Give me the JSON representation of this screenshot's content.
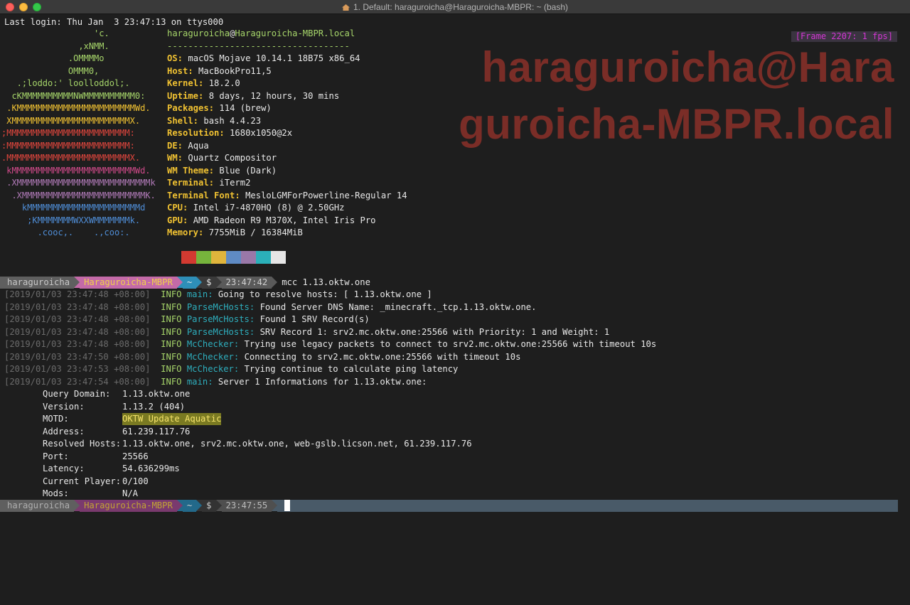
{
  "window": {
    "title": "1. Default: haraguroicha@Haraguroicha-MBPR: ~ (bash)",
    "fps_badge": "[Frame 2207: 1 fps]"
  },
  "last_login": "Last login: Thu Jan  3 23:47:13 on ttys000",
  "logo_lines": [
    {
      "text": "                  'c.",
      "color": "#a6d56a"
    },
    {
      "text": "               ,xNMM.",
      "color": "#a6d56a"
    },
    {
      "text": "             .OMMMMo",
      "color": "#a6d56a"
    },
    {
      "text": "             OMMM0,",
      "color": "#a6d56a"
    },
    {
      "text": "   .;loddo:' loolloddol;.",
      "color": "#a6d56a"
    },
    {
      "text": "  cKMMMMMMMMMMNWMMMMMMMMMM0:",
      "color": "#a6d56a"
    },
    {
      "text": " .KMMMMMMMMMMMMMMMMMMMMMMMWd.",
      "color": "#f1c232"
    },
    {
      "text": " XMMMMMMMMMMMMMMMMMMMMMMMX.",
      "color": "#f1c232"
    },
    {
      "text": ";MMMMMMMMMMMMMMMMMMMMMMMM:",
      "color": "#e0463d"
    },
    {
      "text": ":MMMMMMMMMMMMMMMMMMMMMMMM:",
      "color": "#e0463d"
    },
    {
      "text": ".MMMMMMMMMMMMMMMMMMMMMMMMX.",
      "color": "#e0463d"
    },
    {
      "text": " kMMMMMMMMMMMMMMMMMMMMMMMMWd.",
      "color": "#d04a8a"
    },
    {
      "text": " .XMMMMMMMMMMMMMMMMMMMMMMMMMMk",
      "color": "#b07ab7"
    },
    {
      "text": "  .XMMMMMMMMMMMMMMMMMMMMMMMMK.",
      "color": "#b07ab7"
    },
    {
      "text": "    kMMMMMMMMMMMMMMMMMMMMMMd",
      "color": "#4f8dd6"
    },
    {
      "text": "     ;KMMMMMMMWXXWMMMMMMMk.",
      "color": "#4f8dd6"
    },
    {
      "text": "       .cooc,.    .,coo:.",
      "color": "#4f8dd6"
    }
  ],
  "system": {
    "user": "haraguroicha",
    "at": "@",
    "host": "Haraguroicha-MBPR.local",
    "separator": "-----------------------------------",
    "fields": [
      {
        "key": "OS:",
        "value": "macOS Mojave 10.14.1 18B75 x86_64"
      },
      {
        "key": "Host:",
        "value": "MacBookPro11,5"
      },
      {
        "key": "Kernel:",
        "value": "18.2.0"
      },
      {
        "key": "Uptime:",
        "value": "8 days, 12 hours, 30 mins"
      },
      {
        "key": "Packages:",
        "value": "114 (brew)"
      },
      {
        "key": "Shell:",
        "value": "bash 4.4.23"
      },
      {
        "key": "Resolution:",
        "value": "1680x1050@2x"
      },
      {
        "key": "DE:",
        "value": "Aqua"
      },
      {
        "key": "WM:",
        "value": "Quartz Compositor"
      },
      {
        "key": "WM Theme:",
        "value": "Blue (Dark)"
      },
      {
        "key": "Terminal:",
        "value": "iTerm2"
      },
      {
        "key": "Terminal Font:",
        "value": "MesloLGMForPowerline-Regular 14"
      },
      {
        "key": "CPU:",
        "value": "Intel i7-4870HQ (8) @ 2.50GHz"
      },
      {
        "key": "GPU:",
        "value": "AMD Radeon R9 M370X, Intel Iris Pro"
      },
      {
        "key": "Memory:",
        "value": "7755MiB / 16384MiB"
      }
    ],
    "palette": [
      "#d33a31",
      "#76b43c",
      "#e0b53c",
      "#5f8bc4",
      "#9a78a8",
      "#2bb0b9",
      "#e6e6e6"
    ]
  },
  "watermark": {
    "line1": "haraguroicha@Hara",
    "line2": "guroicha-MBPR.local"
  },
  "prompt1": {
    "user": "haraguroicha",
    "host": "Haraguroicha-MBPR",
    "dir": "~",
    "symbol": "$",
    "time": "23:47:42",
    "command": "mcc 1.13.oktw.one"
  },
  "logs": [
    {
      "ts": "[2019/01/03 23:47:48 +08:00]",
      "level": "INFO",
      "module": "main:",
      "msg": "Going to resolve hosts: [ 1.13.oktw.one ]"
    },
    {
      "ts": "[2019/01/03 23:47:48 +08:00]",
      "level": "INFO",
      "module": "ParseMcHosts:",
      "msg": "Found Server DNS Name: _minecraft._tcp.1.13.oktw.one."
    },
    {
      "ts": "[2019/01/03 23:47:48 +08:00]",
      "level": "INFO",
      "module": "ParseMcHosts:",
      "msg": "Found 1 SRV Record(s)"
    },
    {
      "ts": "[2019/01/03 23:47:48 +08:00]",
      "level": "INFO",
      "module": "ParseMcHosts:",
      "msg": "SRV Record 1: srv2.mc.oktw.one:25566 with Priority: 1 and Weight: 1"
    },
    {
      "ts": "[2019/01/03 23:47:48 +08:00]",
      "level": "INFO",
      "module": "McChecker:",
      "msg": "Trying use legacy packets to connect to srv2.mc.oktw.one:25566 with timeout 10s"
    },
    {
      "ts": "[2019/01/03 23:47:50 +08:00]",
      "level": "INFO",
      "module": "McChecker:",
      "msg": "Connecting to srv2.mc.oktw.one:25566 with timeout 10s"
    },
    {
      "ts": "[2019/01/03 23:47:53 +08:00]",
      "level": "INFO",
      "module": "McChecker:",
      "msg": "Trying continue to calculate ping latency"
    },
    {
      "ts": "[2019/01/03 23:47:54 +08:00]",
      "level": "INFO",
      "module": "main:",
      "msg": "Server 1 Informations for 1.13.oktw.one:"
    }
  ],
  "server_info": [
    {
      "key": "Query Domain:",
      "value": "1.13.oktw.one",
      "highlight": false
    },
    {
      "key": "Version:",
      "value": "1.13.2 (404)",
      "highlight": false
    },
    {
      "key": "MOTD:",
      "value": "OKTW Update Aquatic",
      "highlight": true
    },
    {
      "key": "Address:",
      "value": "61.239.117.76",
      "highlight": false
    },
    {
      "key": "Resolved Hosts:",
      "value": "1.13.oktw.one, srv2.mc.oktw.one, web-gslb.licson.net, 61.239.117.76",
      "highlight": false
    },
    {
      "key": "Port:",
      "value": "25566",
      "highlight": false
    },
    {
      "key": "Latency:",
      "value": "54.636299ms",
      "highlight": false
    },
    {
      "key": "Current Player:",
      "value": "0/100",
      "highlight": false
    },
    {
      "key": "Mods:",
      "value": "N/A",
      "highlight": false
    }
  ],
  "prompt2": {
    "user": "haraguroicha",
    "host": "Haraguroicha-MBPR",
    "dir": "~",
    "symbol": "$",
    "time": "23:47:55"
  }
}
